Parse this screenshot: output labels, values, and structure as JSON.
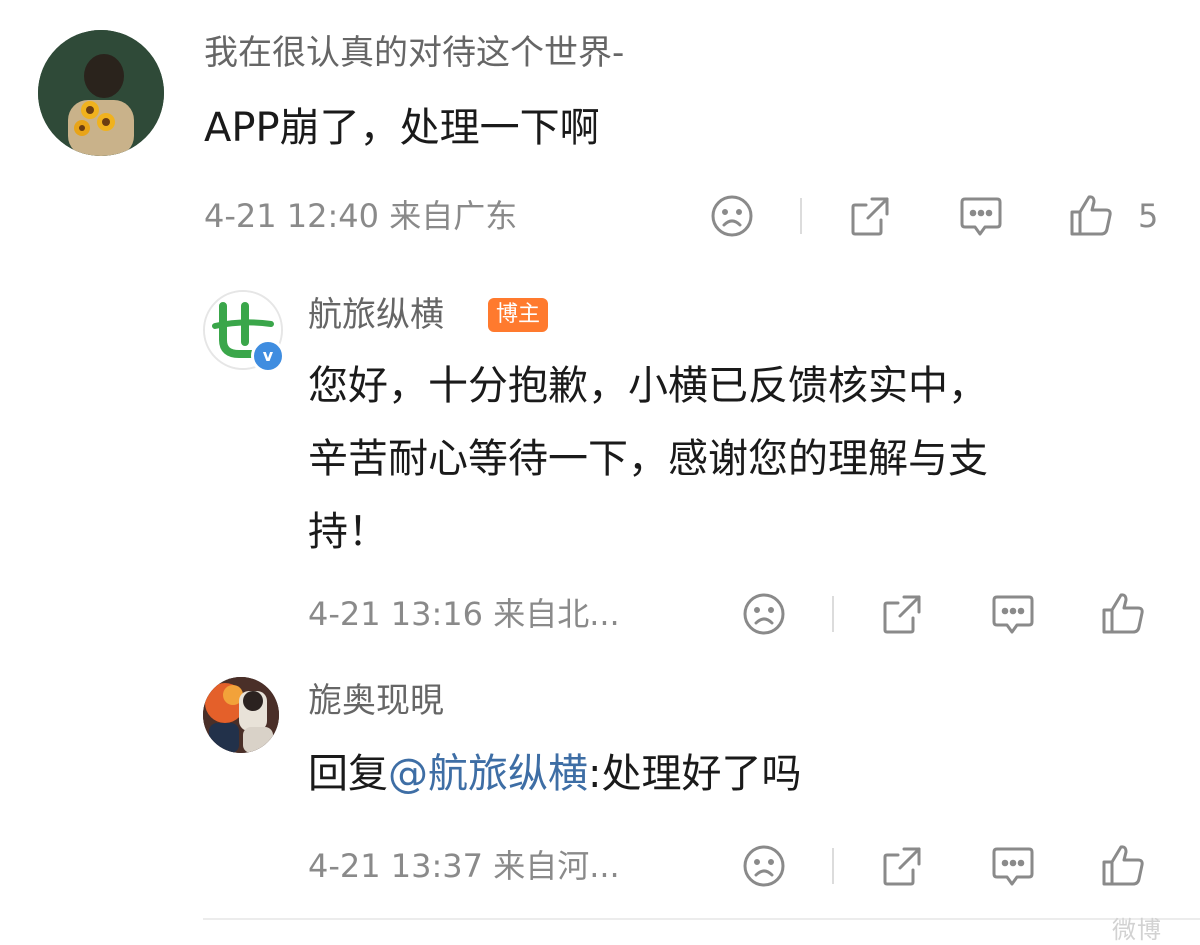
{
  "comment": {
    "username": "我在很认真的对待这个世界-",
    "text": "APP崩了，处理一下啊",
    "meta": "4-21 12:40 来自广东",
    "like_count": "5"
  },
  "replies": [
    {
      "username": "航旅纵横",
      "badge": "博主",
      "verified_mark": "v",
      "lines": [
        "您好，十分抱歉，小横已反馈核实中，",
        "辛苦耐心等待一下，感谢您的理解与支",
        "持！"
      ],
      "meta": "4-21 13:16 来自北..."
    },
    {
      "username": "旎奥现晛",
      "reply_prefix": "回复",
      "mention": "@航旅纵横",
      "reply_suffix": ":处理好了吗",
      "meta": "4-21 13:37 来自河..."
    }
  ],
  "watermark": "微博"
}
